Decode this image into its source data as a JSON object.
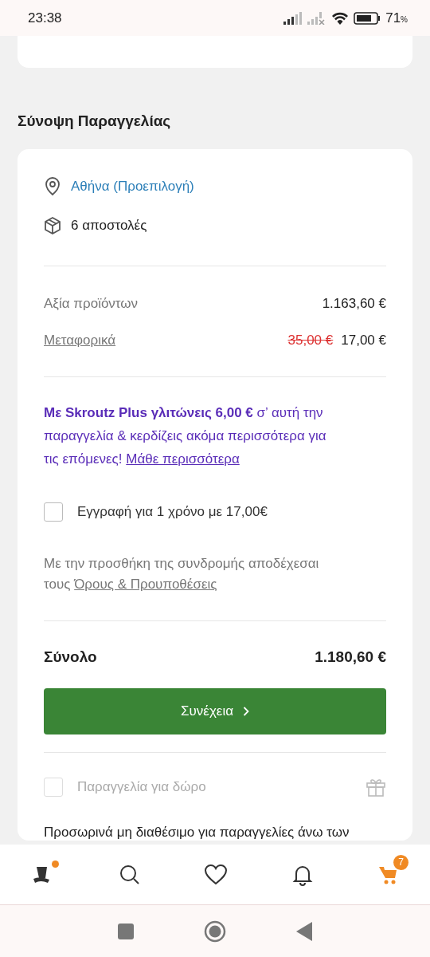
{
  "status_bar": {
    "time": "23:38",
    "battery": "71",
    "battery_unit": "%"
  },
  "summary": {
    "title": "Σύνοψη Παραγγελίας",
    "location": "Αθήνα (Προεπιλογή)",
    "shipments": "6 αποστολές",
    "lines": [
      {
        "label": "Αξία προϊόντων",
        "kind": "plain",
        "value": "1.163,60 €"
      },
      {
        "label": "Μεταφορικά",
        "kind": "discounted",
        "old_value": "35,00 €",
        "value": "17,00 €"
      }
    ],
    "plus_promo": {
      "text": "**Με Skroutz Plus γλιτώνεις 6,00 €** σ’ αυτή την παραγγελία & κερδίζεις ακόμα περισσότερα για τις επόμενες!",
      "link": "Μάθε περισσότερα"
    },
    "subscribe": {
      "label": "Εγγραφή για 1 χρόνο με 17,00€",
      "checked": false,
      "disabled": false
    },
    "terms": {
      "text": "Με την προσθήκη της συνδρομής αποδέχεσαι τους",
      "link": "Όρους & Προυποθέσεις"
    },
    "total": {
      "label": "Σύνολο",
      "value": "1.180,60 €"
    },
    "continue_button": "Συνέχεια",
    "gift": {
      "label": "Παραγγελία για δώρο",
      "checked": false,
      "disabled": true
    },
    "notice": "Προσωρινά μη διαθέσιμο για παραγγελίες άνω των"
  },
  "bottom_nav": [
    {
      "kind": "profile",
      "dot": true,
      "selected": false
    },
    {
      "kind": "search",
      "selected": false
    },
    {
      "kind": "favorites",
      "selected": false
    },
    {
      "kind": "notifications",
      "selected": false
    },
    {
      "kind": "cart",
      "selected": true,
      "badge": "7"
    }
  ]
}
